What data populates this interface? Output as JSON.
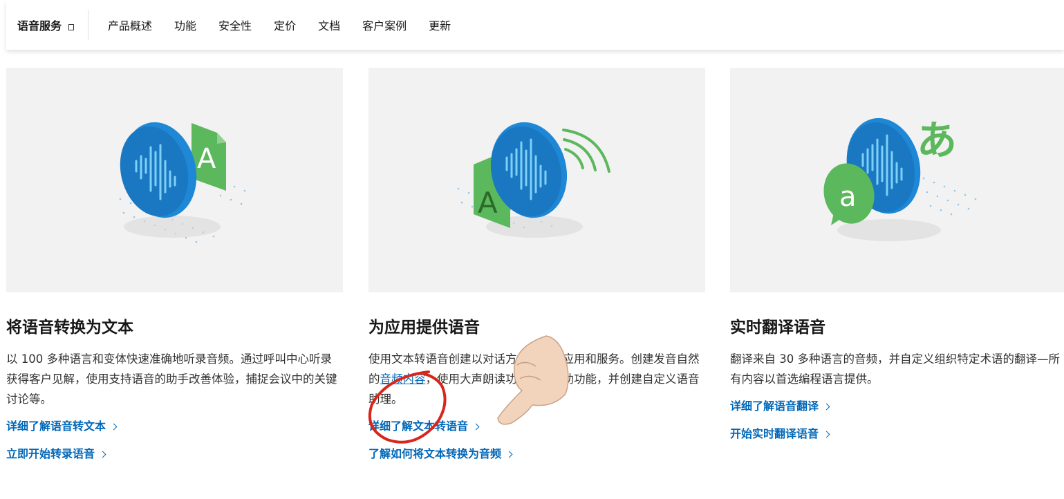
{
  "nav": {
    "brand": "语音服务",
    "items": [
      "产品概述",
      "功能",
      "安全性",
      "定价",
      "文档",
      "客户案例",
      "更新"
    ]
  },
  "cards": [
    {
      "title": "将语音转换为文本",
      "desc": "以 100 多种语言和变体快速准确地听录音频。通过呼叫中心听录获得客户见解，使用支持语音的助手改善体验，捕捉会议中的关键讨论等。",
      "links": [
        "详细了解语音转文本",
        "立即开始转录语音"
      ]
    },
    {
      "title": "为应用提供语音",
      "desc_part1": "使用文本转语音创建以对话方式朗读的应用和服务。创建发音自然的",
      "desc_link": "音频内容",
      "desc_part2": "，使用大声朗读功能改进辅助功能，并创建自定义语音助理。",
      "links": [
        "详细了解文本转语音",
        "了解如何将文本转换为音频"
      ]
    },
    {
      "title": "实时翻译语音",
      "desc": "翻译来自 30 多种语言的音频，并自定义组织特定术语的翻译—所有内容以首选编程语言提供。",
      "links": [
        "详细了解语音翻译",
        "开始实时翻译语音"
      ]
    }
  ],
  "colors": {
    "link": "#0067b8",
    "hero_bg": "#f2f2f3",
    "bubble_blue": "#1e88d6",
    "doc_green": "#5cb85c",
    "annotation_red": "#d9261c"
  }
}
